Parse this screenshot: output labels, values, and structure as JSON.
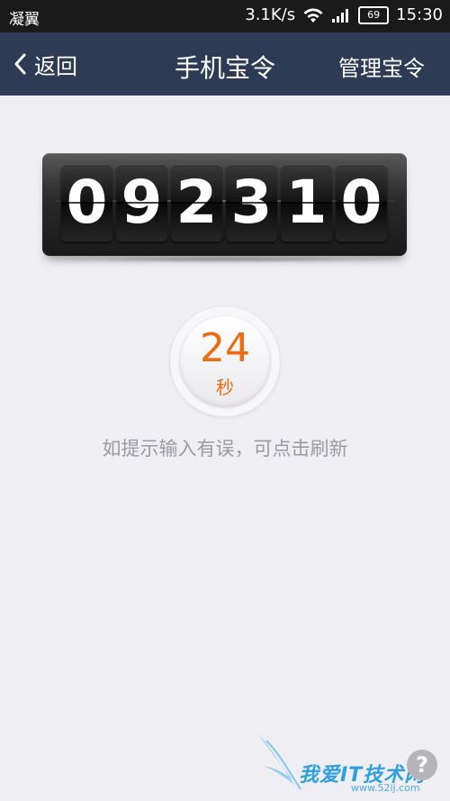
{
  "status_bar": {
    "carrier": "凝翼",
    "network_speed": "3.1K/s",
    "battery": "69",
    "time": "15:30",
    "icons": [
      "wifi-icon",
      "signal-icon",
      "battery-icon"
    ]
  },
  "nav": {
    "back_label": "返回",
    "title": "手机宝令",
    "manage_label": "管理宝令",
    "background": "#2d3b55"
  },
  "token": {
    "digits": [
      "0",
      "9",
      "2",
      "3",
      "1",
      "0"
    ]
  },
  "timer": {
    "seconds": "24",
    "unit": "秒",
    "color": "#f06a0f"
  },
  "hint": "如提示输入有误，可点击刷新",
  "watermark": {
    "text": "我爱IT技术网",
    "url": "www.52ij.com",
    "help_icon": "question-mark-icon"
  }
}
